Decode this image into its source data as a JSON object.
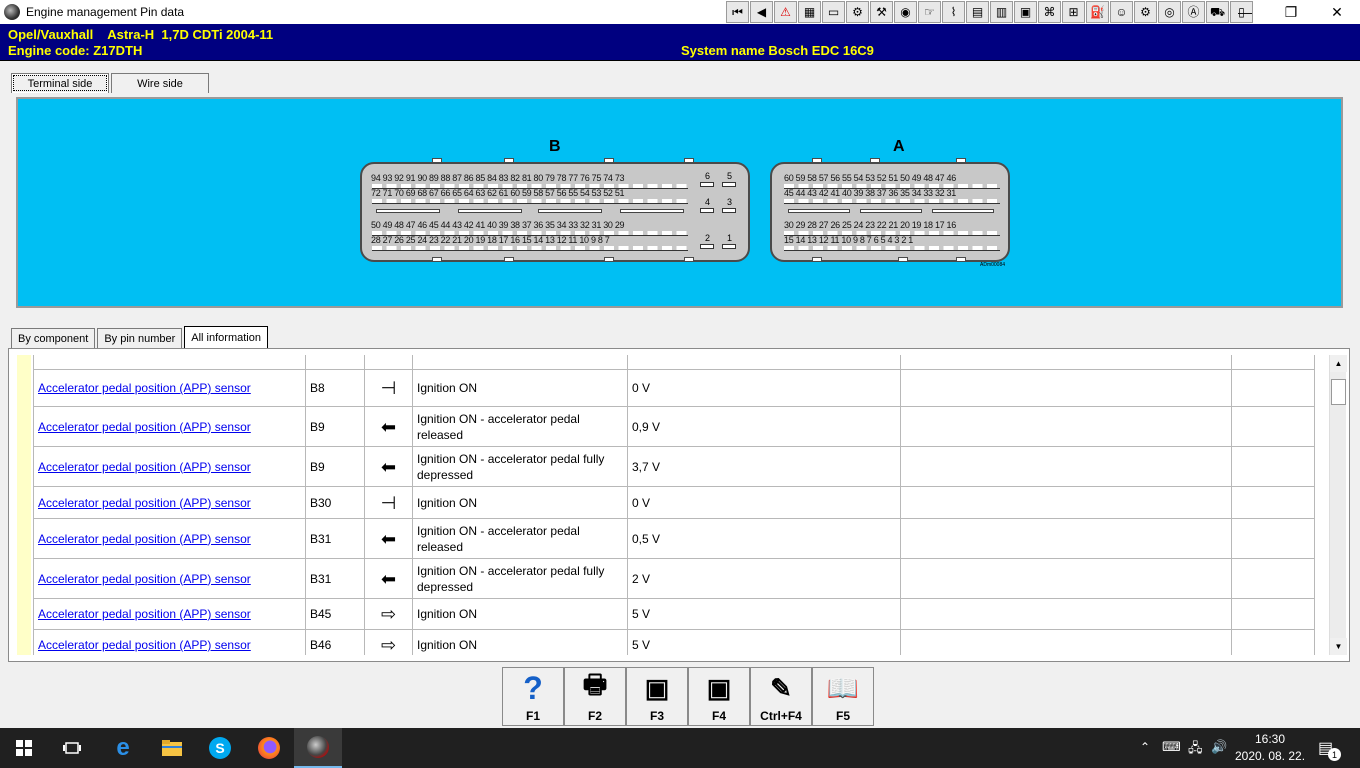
{
  "window": {
    "title": "Engine management Pin data"
  },
  "toolbar": {
    "icons": [
      "first-page-icon",
      "previous-page-icon",
      "warning-icon",
      "film-icon",
      "screen-icon",
      "gear-icon",
      "tools-icon",
      "disc-icon",
      "hand-pointer-icon",
      "wiring-icon",
      "component-icon",
      "vehicle-icon",
      "battery-icon",
      "calibration-icon",
      "connector-icon",
      "oil-can-icon",
      "smiley-icon",
      "engine-icon",
      "tyre-icon",
      "abs-icon",
      "car-icon",
      "clipboard-icon"
    ]
  },
  "header": {
    "vehicle": "Opel/Vauxhall    Astra-H  1,7D CDTi 2004-11",
    "engine_code": "Engine code: Z17DTH",
    "system_name": "System name Bosch EDC 16C9"
  },
  "view_tabs": [
    "Terminal side",
    "Wire side"
  ],
  "connector": {
    "label_b": "B",
    "label_a": "A",
    "small_code": "ADm00084",
    "b_row1": "94 93 92 91 90 89 88 87 86 85 84 83 82 81 80 79 78 77 76 75 74 73",
    "b_row2": "72 71 70 69 68 67 66 65 64 63 62 61 60 59 58 57 56 55 54 53 52 51",
    "b_row3": "50 49 48 47 46 45 44 43 42 41 40 39 38 37 36 35 34 33 32 31 30 29",
    "b_row4": "28 27 26 25 24 23 22 21 20 19 18 17 16 15 14 13 12 11 10 9 8 7",
    "b_side": [
      "6",
      "5",
      "4",
      "3",
      "2",
      "1"
    ],
    "a_row1": "60 59 58 57 56 55 54 53 52 51 50 49 48 47 46",
    "a_row2": "45 44 43 42 41 40 39 38 37 36 35 34 33 32 31",
    "a_row3": "30 29 28 27 26 25 24 23 22 21 20 19 18 17 16",
    "a_row4": "15 14 13 12 11 10 9 8 7 6 5 4 3 2 1"
  },
  "info_tabs": [
    "By component",
    "By pin number",
    "All information"
  ],
  "table": {
    "rows": [
      {
        "component": "Accelerator pedal position (APP) sensor",
        "pin": "B8",
        "icon": "ground-arrow-icon",
        "symbol": "⊣",
        "condition": "Ignition ON",
        "value": "0 V"
      },
      {
        "component": "Accelerator pedal position (APP) sensor",
        "pin": "B9",
        "icon": "input-arrow-icon",
        "symbol": "⬅",
        "condition": "Ignition ON - accelerator pedal released",
        "value": "0,9 V"
      },
      {
        "component": "Accelerator pedal position (APP) sensor",
        "pin": "B9",
        "icon": "input-arrow-icon",
        "symbol": "⬅",
        "condition": "Ignition ON - accelerator pedal fully depressed",
        "value": "3,7 V"
      },
      {
        "component": "Accelerator pedal position (APP) sensor",
        "pin": "B30",
        "icon": "ground-arrow-icon",
        "symbol": "⊣",
        "condition": "Ignition ON",
        "value": "0 V"
      },
      {
        "component": "Accelerator pedal position (APP) sensor",
        "pin": "B31",
        "icon": "input-arrow-icon",
        "symbol": "⬅",
        "condition": "Ignition ON - accelerator pedal released",
        "value": "0,5 V"
      },
      {
        "component": "Accelerator pedal position (APP) sensor",
        "pin": "B31",
        "icon": "input-arrow-icon",
        "symbol": "⬅",
        "condition": "Ignition ON - accelerator pedal fully depressed",
        "value": "2 V"
      },
      {
        "component": "Accelerator pedal position (APP) sensor",
        "pin": "B45",
        "icon": "supply-arrow-icon",
        "symbol": "⇨",
        "condition": "Ignition ON",
        "value": "5 V"
      },
      {
        "component": "Accelerator pedal position (APP) sensor",
        "pin": "B46",
        "icon": "supply-arrow-icon",
        "symbol": "⇨",
        "condition": "Ignition ON",
        "value": "5 V"
      }
    ]
  },
  "function_keys": [
    {
      "label": "F1",
      "icon": "help-icon",
      "glyph": "?"
    },
    {
      "label": "F2",
      "icon": "printer-icon",
      "glyph": "🖶"
    },
    {
      "label": "F3",
      "icon": "screen-capture-icon",
      "glyph": "▣"
    },
    {
      "label": "F4",
      "icon": "screen-copy-icon",
      "glyph": "▣"
    },
    {
      "label": "Ctrl+F4",
      "icon": "notes-icon",
      "glyph": "✎"
    },
    {
      "label": "F5",
      "icon": "book-icon",
      "glyph": "📖"
    }
  ],
  "taskbar": {
    "time": "16:30",
    "date": "2020. 08. 22.",
    "notification_count": "1"
  }
}
